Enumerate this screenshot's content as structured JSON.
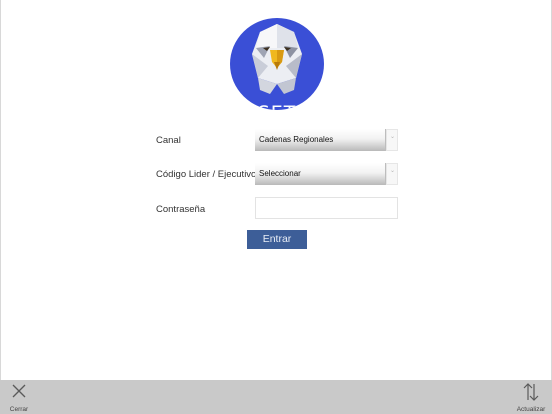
{
  "logo": {
    "text": "SET",
    "circle_color": "#3a4fd6"
  },
  "form": {
    "canal": {
      "label": "Canal",
      "selected": "Cadenas Regionales"
    },
    "codigo": {
      "label": "Código Lider / Ejecutivo",
      "selected": "Seleccionar"
    },
    "password": {
      "label": "Contraseña",
      "value": ""
    },
    "submit_label": "Entrar",
    "submit_color": "#3d5e98"
  },
  "bottombar": {
    "close_label": "Cerrar",
    "refresh_label": "Actualizar"
  },
  "icons": {
    "select_arrow": "chevron-icon",
    "close": "close-icon",
    "refresh": "sort-arrows-icon"
  }
}
